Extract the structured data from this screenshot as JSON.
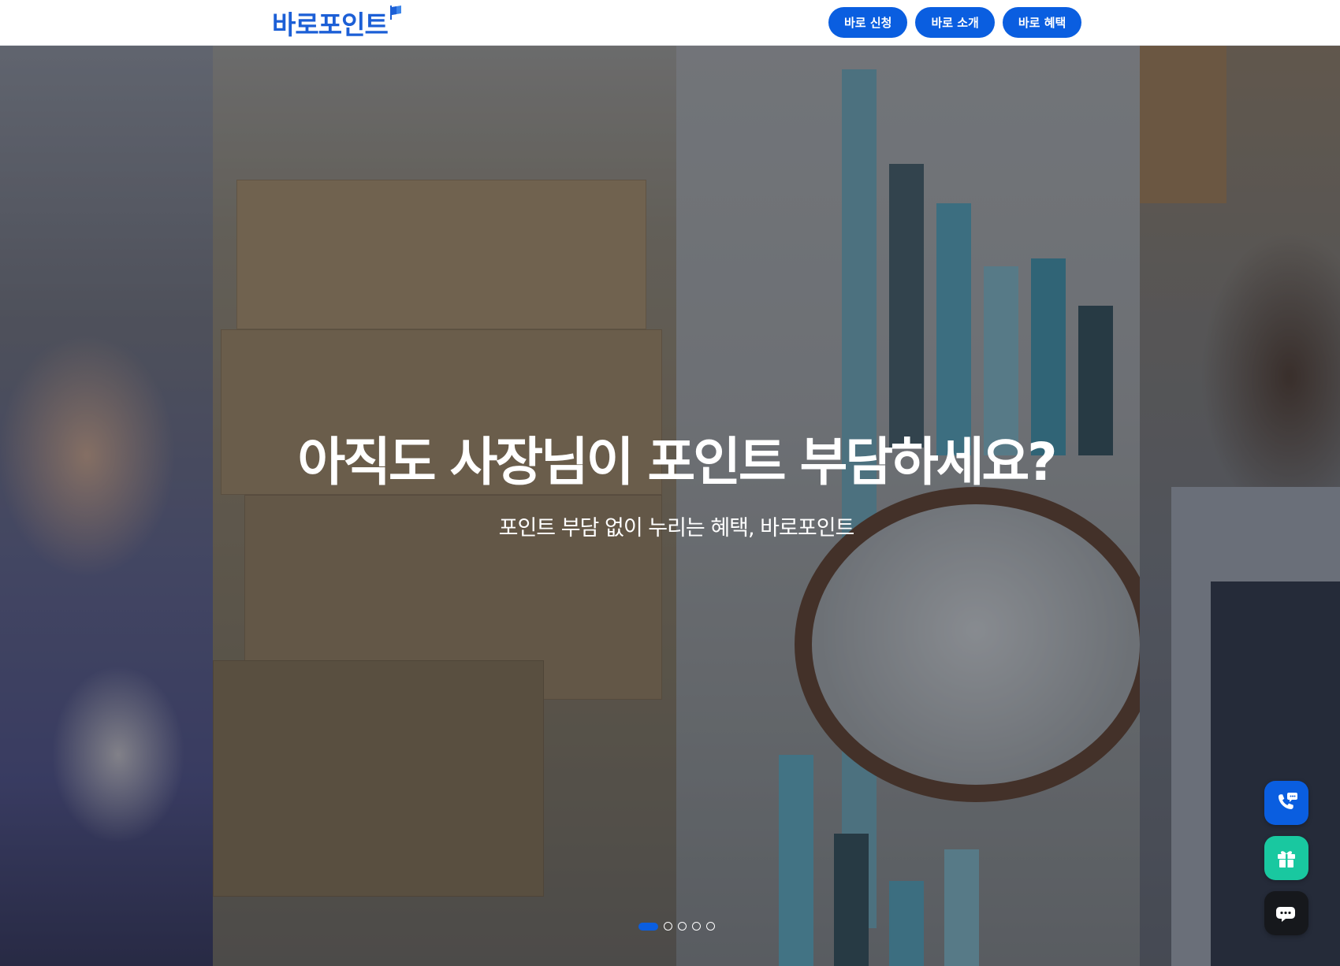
{
  "header": {
    "logo_text": "바로포인트",
    "nav": [
      "바로 신청",
      "바로 소개",
      "바로 혜택"
    ]
  },
  "hero": {
    "title": "아직도 사장님이 포인트 부담하세요?",
    "subtitle": "포인트 부담 없이 누리는 혜택, 바로포인트",
    "slide_count": 5,
    "active_slide": 1
  },
  "floating": {
    "icons": [
      "phone-chat-icon",
      "gift-icon",
      "chat-bubbles-icon"
    ]
  },
  "colors": {
    "brand": "#0a5ee0",
    "logo": "#1c5fd6",
    "gift_button": "#19c8a0",
    "chat_button": "#16181c"
  }
}
